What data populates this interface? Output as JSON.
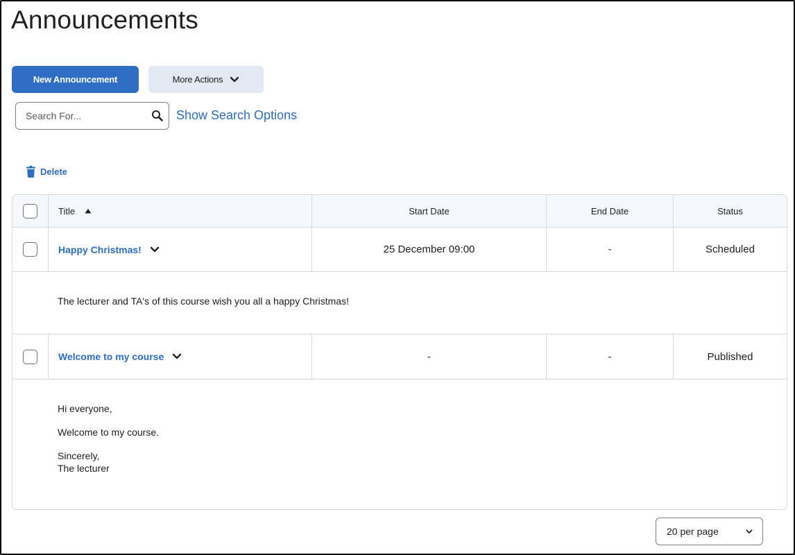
{
  "page": {
    "title": "Announcements"
  },
  "toolbar": {
    "new_label": "New Announcement",
    "more_actions_label": "More Actions"
  },
  "search": {
    "placeholder": "Search For...",
    "value": "",
    "options_link": "Show Search Options"
  },
  "bulk_actions": {
    "delete_label": "Delete"
  },
  "table": {
    "columns": [
      "Title",
      "Start Date",
      "End Date",
      "Status"
    ],
    "sort": {
      "column": "Title",
      "direction": "ascending"
    },
    "rows": [
      {
        "title": "Happy Christmas!",
        "start_date": "25 December 09:00",
        "end_date": "-",
        "status": "Scheduled",
        "body": [
          "The lecturer and TA's of this course wish you all a happy Christmas!"
        ]
      },
      {
        "title": "Welcome to my course",
        "start_date": "-",
        "end_date": "-",
        "status": "Published",
        "body": [
          "Hi everyone,",
          "Welcome to my course.",
          "Sincerely,",
          "The lecturer"
        ]
      }
    ]
  },
  "pagination": {
    "per_page_label": "20 per page"
  },
  "colors": {
    "accent": "#2e6dc2",
    "secondary_button": "#e3e9f1",
    "header_bg": "#f5f8fc",
    "border": "#d5dae0"
  },
  "icons": {
    "more_actions": "chevron-down-icon",
    "search": "search-icon",
    "delete": "trash-icon",
    "sort": "sort-ascending-icon",
    "row_menu": "chevron-down-icon",
    "per_page": "chevron-down-icon"
  }
}
